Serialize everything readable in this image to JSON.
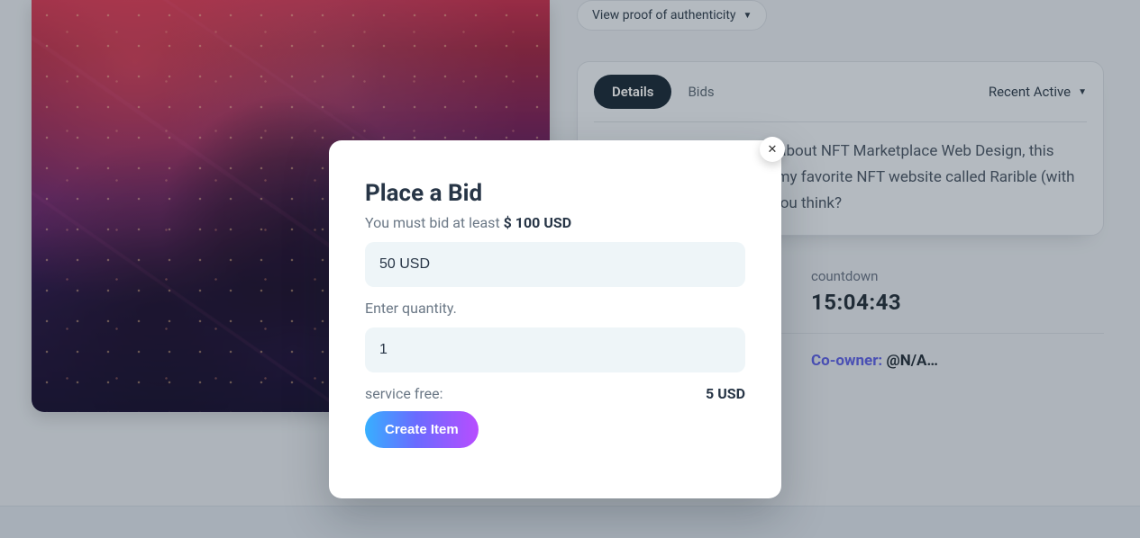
{
  "authenticity": {
    "label": "View proof of authenticity"
  },
  "tabs": {
    "details": "Details",
    "bids": "Bids"
  },
  "sort": {
    "label": "Recent Active"
  },
  "description": "Hey guys! New exploration about NFT Marketplace Web Design, this time I'm inspired by one of my favorite NFT website called Rarible (with crypto payment)! What do you think?",
  "countdown": {
    "label": "countdown",
    "value": "15:04:43"
  },
  "coowner": {
    "label": "Co-owner: ",
    "value": "@N/A…"
  },
  "modal": {
    "title": "Place a Bid",
    "sub_prefix": "You must bid at least ",
    "sub_bold": "$ 100 USD",
    "amount_value": "50 USD",
    "quantity_label": "Enter quantity.",
    "quantity_value": "1",
    "fee_label": "service free:",
    "fee_value": "5 USD",
    "create_label": "Create Item",
    "close_glyph": "✕"
  }
}
